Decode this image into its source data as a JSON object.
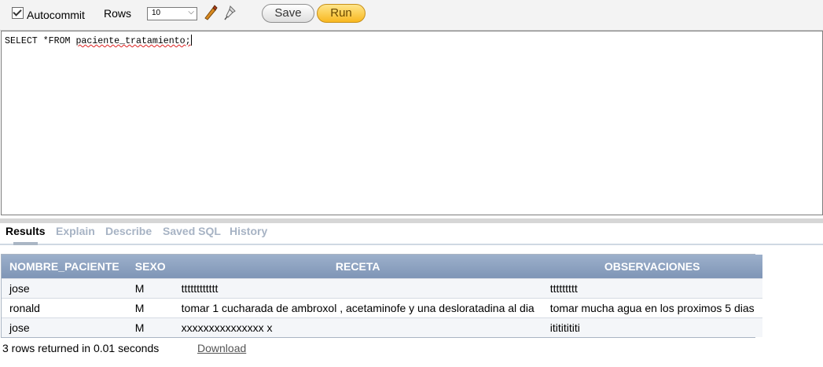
{
  "toolbar": {
    "autocommit_label": "Autocommit",
    "autocommit_checked": true,
    "rows_label": "Rows",
    "rows_value": "10",
    "save_label": "Save",
    "run_label": "Run",
    "icons": [
      "eraser-icon",
      "pin-icon"
    ]
  },
  "editor": {
    "prefix": "SELECT *FROM ",
    "table_name": "paciente_tratamiento;"
  },
  "tabs": [
    "Results",
    "Explain",
    "Describe",
    "Saved SQL",
    "History"
  ],
  "results": {
    "columns": [
      "NOMBRE_PACIENTE",
      "SEXO",
      "RECETA",
      "OBSERVACIONES"
    ],
    "rows": [
      [
        "jose",
        "M",
        "tttttttttttt",
        "ttttttttt"
      ],
      [
        "ronald",
        "M",
        "tomar 1 cucharada de ambroxol , acetaminofe y una desloratadina al dia",
        "tomar mucha agua en los proximos 5 dias"
      ],
      [
        "jose",
        "M",
        "xxxxxxxxxxxxxxx x",
        "itititititi"
      ]
    ],
    "status": "3 rows returned in 0.01 seconds",
    "download_label": "Download"
  },
  "colors": {
    "run_button": "#f8b820",
    "header_bg": "#8a9fbe",
    "tab_inactive": "#a7b3c4"
  }
}
